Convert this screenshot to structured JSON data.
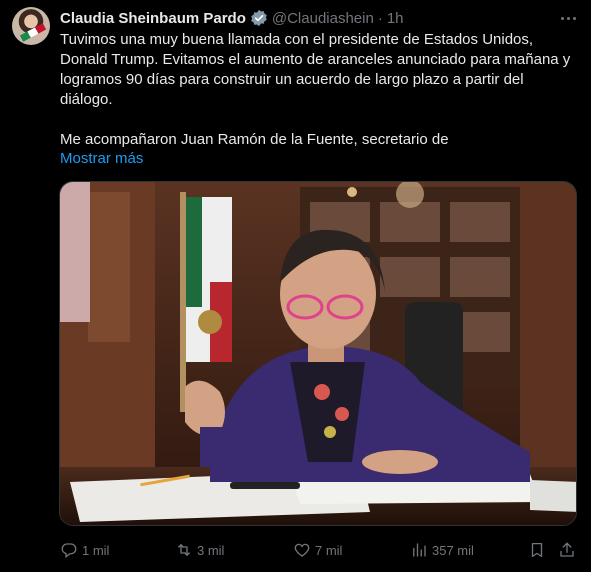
{
  "tweet": {
    "author_name": "Claudia Sheinbaum Pardo",
    "handle": "@Claudiashein",
    "separator": "·",
    "time": "1h",
    "text": "Tuvimos una muy buena llamada con el presidente de Estados Unidos, Donald Trump. Evitamos el aumento de aranceles anunciado para mañana y logramos 90 días para construir un acuerdo de largo plazo a partir del diálogo.\n\nMe acompañaron Juan Ramón de la Fuente, secretario de",
    "show_more": "Mostrar más",
    "media_description_icon": "photo"
  },
  "icons": {
    "avatar": "avatar-photo",
    "badge": "verified-gray-badge-icon",
    "more": "more-dots-icon",
    "reply": "reply-icon",
    "retweet": "retweet-icon",
    "like": "heart-icon",
    "views": "views-chart-icon",
    "bookmark": "bookmark-icon",
    "share": "share-icon"
  },
  "actions": {
    "replies": "1 mil",
    "retweets": "3 mil",
    "likes": "7 mil",
    "views": "357 mil"
  },
  "colors": {
    "background": "#000000",
    "text": "#e7e9ea",
    "muted": "#71767b",
    "link": "#1d9bf0"
  }
}
